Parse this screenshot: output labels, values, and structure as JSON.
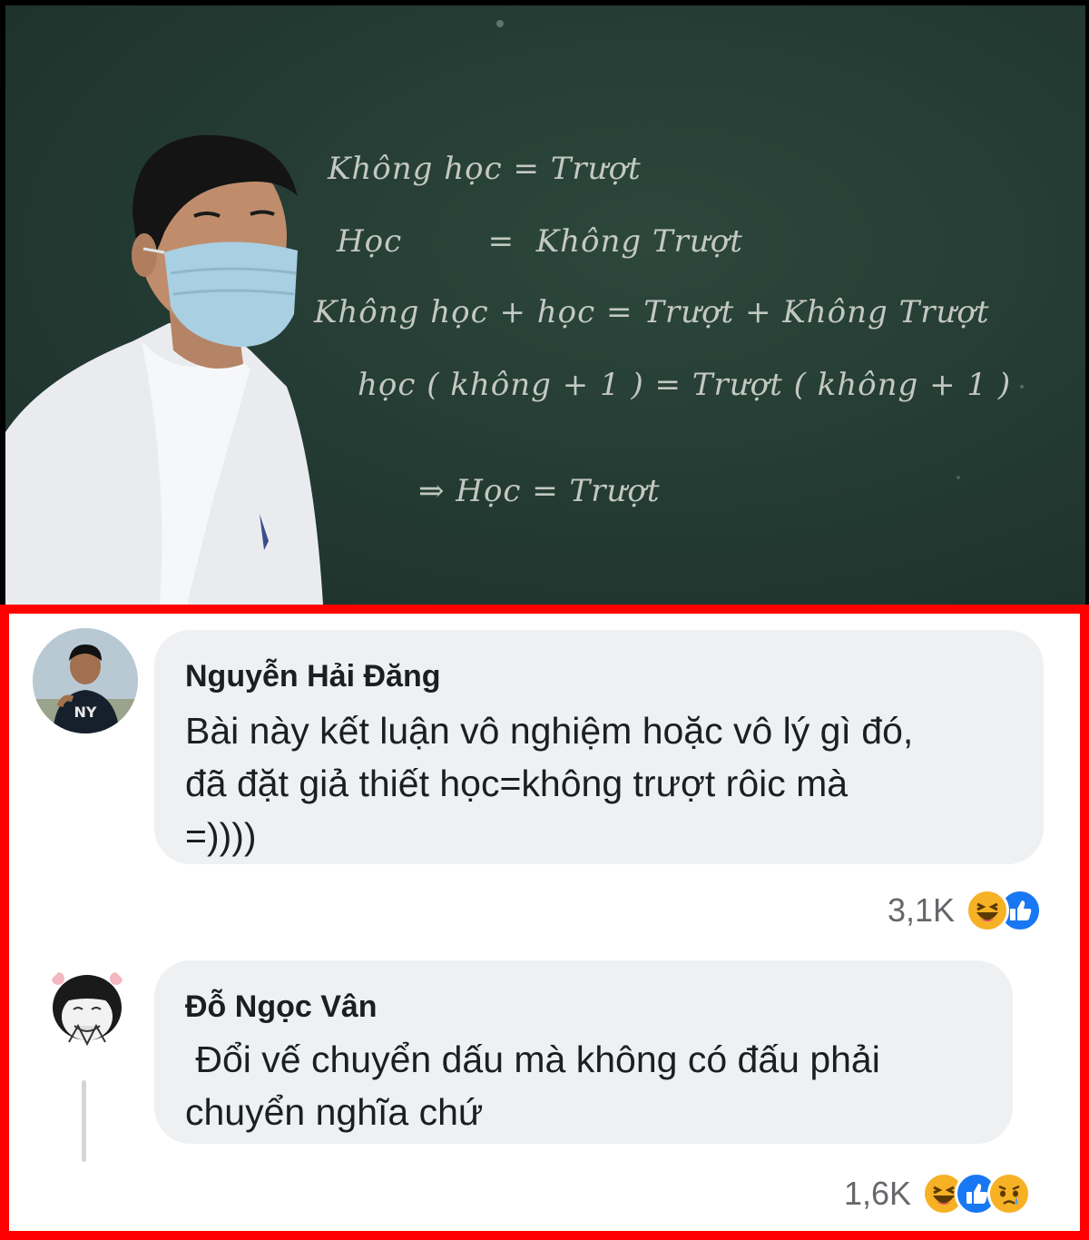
{
  "chalkboard": {
    "lines": [
      "Không học  =  Trượt",
      "Học        =  Không Trượt",
      "Không học + học  =  Trượt + Không Trượt",
      "học ( không + 1 )  =  Trượt ( không + 1 )",
      "⇒  Học = Trượt"
    ]
  },
  "comments": [
    {
      "author": "Nguyễn Hải Đăng",
      "lines": [
        "Bài này kết luận vô nghiệm hoặc vô lý gì đó,",
        "đã đặt giả thiết học=không trượt rôic mà",
        "=))))"
      ],
      "reaction_count": "3,1K",
      "reactions": [
        "haha-icon",
        "like-icon"
      ]
    },
    {
      "author": "Đỗ Ngọc Vân",
      "lines": [
        " Đổi vế chuyển dấu mà không có đấu phải",
        "chuyển nghĩa chứ"
      ],
      "reaction_count": "1,6K",
      "reactions": [
        "haha-icon",
        "like-icon",
        "sad-icon"
      ]
    }
  ],
  "colors": {
    "frame": "#ff0000",
    "bubble": "#eff0f2",
    "chalkboard": "#233a32",
    "like": "#1877f2",
    "haha": "#f7b125"
  }
}
